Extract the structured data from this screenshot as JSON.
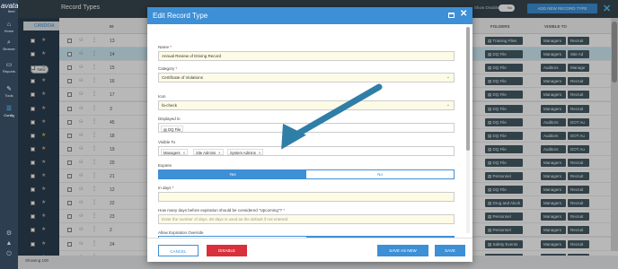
{
  "app": {
    "logo_text": "avatar",
    "logo_sub": "fleet",
    "page_title": "Record Types",
    "show_disabled_label": "Show Disabled?",
    "show_disabled_value": "No",
    "add_button": "ADD NEW RECORD TYPE",
    "close_glyph": "✕"
  },
  "nav": [
    {
      "label": "Home",
      "icon": "home-icon",
      "glyph": "⌂"
    },
    {
      "label": "Browse",
      "icon": "search-icon",
      "glyph": "⌕"
    },
    {
      "label": "Reports",
      "icon": "folder-icon",
      "glyph": "▭"
    },
    {
      "label": "Tools",
      "icon": "wrench-icon",
      "glyph": "✎"
    },
    {
      "label": "Config",
      "icon": "config-icon",
      "glyph": "☰"
    }
  ],
  "left_panel": {
    "tab_label": "CANDIDA",
    "new_button": "New"
  },
  "table": {
    "headers": {
      "id": "ID",
      "folders": "FOLDERS",
      "visible_to": "VISIBLE TO"
    },
    "rows": [
      {
        "id": "13",
        "folder": "Training Files",
        "v1": "Managers",
        "v2": "Recruit",
        "star": false
      },
      {
        "id": "14",
        "folder": "DQ File",
        "v1": "Managers",
        "v2": "Site Ad",
        "star": false,
        "selected": true
      },
      {
        "id": "15",
        "folder": "DQ File",
        "v1": "Auditors",
        "v2": "Manage",
        "star": false
      },
      {
        "id": "16",
        "folder": "DQ File",
        "v1": "Managers",
        "v2": "Recruit",
        "star": false
      },
      {
        "id": "17",
        "folder": "DQ File",
        "v1": "Managers",
        "v2": "Recruit",
        "star": false
      },
      {
        "id": "3",
        "folder": "DQ File",
        "v1": "Managers",
        "v2": "Recruit",
        "star": false
      },
      {
        "id": "45",
        "folder": "DQ File",
        "v1": "Auditors",
        "v2": "DOT Au",
        "star": false
      },
      {
        "id": "18",
        "folder": "DQ File",
        "v1": "Auditors",
        "v2": "DOT Au",
        "star": true
      },
      {
        "id": "19",
        "folder": "DQ File",
        "v1": "Auditors",
        "v2": "DOT Au",
        "star": true
      },
      {
        "id": "20",
        "folder": "DQ File",
        "v1": "Managers",
        "v2": "Recruit",
        "star": false
      },
      {
        "id": "21",
        "folder": "Personnel",
        "v1": "Managers",
        "v2": "Recruit",
        "star": false
      },
      {
        "id": "12",
        "folder": "DQ File",
        "v1": "Managers",
        "v2": "Recruit",
        "star": false
      },
      {
        "id": "22",
        "folder": "Drug and Alcoh",
        "v1": "Managers",
        "v2": "Recruit",
        "star": false
      },
      {
        "id": "23",
        "folder": "Personnel",
        "v1": "Managers",
        "v2": "Recruit",
        "star": false
      },
      {
        "id": "2",
        "folder": "Personnel",
        "v1": "Managers",
        "v2": "Recruit",
        "star": false
      },
      {
        "id": "24",
        "folder": "Safety Events",
        "v1": "Managers",
        "v2": "Recruit",
        "star": false
      },
      {
        "id": "11",
        "folder": "Personnel",
        "v1": "Managers",
        "v2": "Recruit",
        "star": false
      }
    ]
  },
  "footer": {
    "showing_label": "Showing",
    "showing_value": "100"
  },
  "modal": {
    "title": "Edit Record Type",
    "name_label": "Name",
    "name_value": "Annual Review of Driving Record",
    "category_label": "Category",
    "category_value": "Certificate of Violations",
    "whats_this": "What's this?",
    "icon_label": "Icon",
    "icon_value": "fa-check",
    "displayed_in_label": "Displayed in",
    "displayed_in_value": "DQ File",
    "visible_to_label": "Visible To",
    "visible_to_tags": [
      "Managers",
      "Site Admins",
      "System Admins"
    ],
    "expires_label": "Expires",
    "expires_yes": "Yes",
    "expires_no": "No",
    "in_days_label": "In days",
    "in_days_value": "",
    "upcoming_label": "How many days before expiration should be considered \"Upcoming\"?",
    "upcoming_placeholder": "Enter the number of days. 60 days is used as the default if not entered",
    "override_label": "Allow Expiration Override",
    "override_yes": "Yes",
    "override_no": "No",
    "required_mark": "*",
    "cancel": "CANCEL",
    "disable": "DISABLE",
    "save_as_new": "SAVE AS NEW",
    "save": "SAVE"
  },
  "colors": {
    "accent": "#3d8fd6",
    "danger": "#d9303c",
    "nav_bg": "#2c3e50",
    "annotation_arrow": "#2f7ea8"
  }
}
